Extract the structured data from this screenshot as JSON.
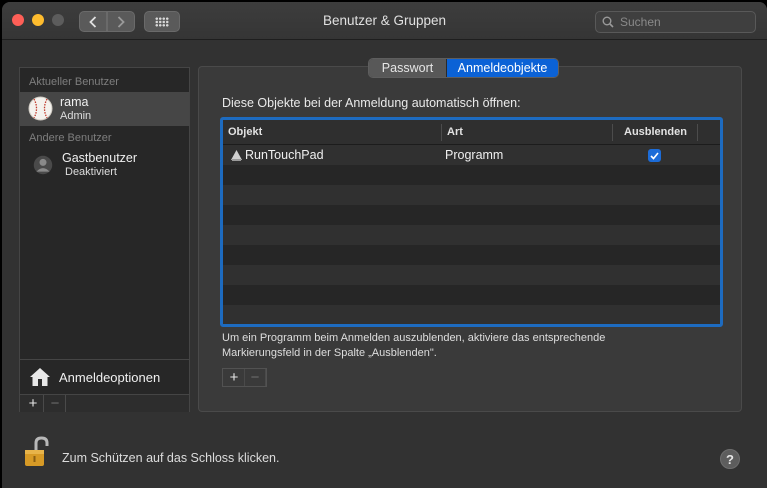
{
  "window": {
    "title": "Benutzer & Gruppen"
  },
  "search": {
    "placeholder": "Suchen"
  },
  "sidebar": {
    "current_section": "Aktueller Benutzer",
    "current_user": {
      "name": "rama",
      "role": "Admin"
    },
    "other_section": "Andere Benutzer",
    "other_users": [
      {
        "name": "Gastbenutzer",
        "role": "Deaktiviert"
      }
    ],
    "options_label": "Anmeldeoptionen",
    "add_symbol": "+",
    "remove_symbol": "−"
  },
  "tabs": [
    {
      "label": "Passwort",
      "selected": false
    },
    {
      "label": "Anmeldeobjekte",
      "selected": true
    }
  ],
  "panel": {
    "heading": "Diese Objekte bei der Anmeldung automatisch öffnen:",
    "columns": {
      "object": "Objekt",
      "type": "Art",
      "hide": "Ausblenden"
    },
    "rows": [
      {
        "name": "RunTouchPad",
        "type": "Programm",
        "hidden": true
      }
    ],
    "hint_line1": "Um ein Programm beim Anmelden auszublenden, aktiviere das entsprechende",
    "hint_line2": "Markierungsfeld in der Spalte „Ausblenden\".",
    "add_symbol": "+",
    "remove_symbol": "−"
  },
  "footer": {
    "lock_label": "Zum Schützen auf das Schloss klicken.",
    "help_symbol": "?"
  },
  "colors": {
    "accent": "#0b62d6",
    "table_focus": "#1d6bc0",
    "window_bg": "#323232"
  }
}
